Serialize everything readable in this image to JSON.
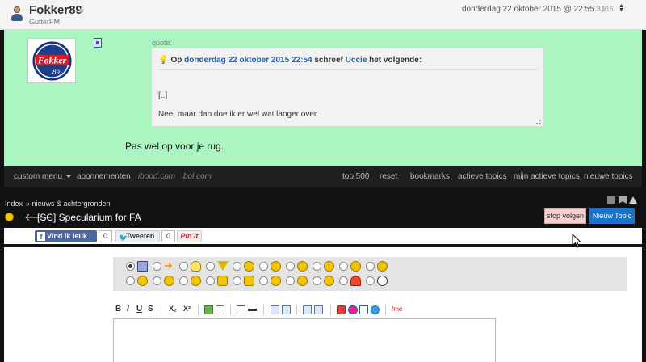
{
  "post": {
    "username": "Fokker89",
    "user_title": "GutterFM",
    "date": "donderdag 22 oktober 2015 @ 22:55",
    "seconds": ":31",
    "post_number": "#16",
    "star": "★",
    "quote_label": "quote:",
    "quote": {
      "prefix": "Op",
      "date_link": "donderdag 22 oktober 2015 22:54",
      "middle": "schreef",
      "author": "Uccie",
      "suffix": "het volgende:",
      "line1": "[..]",
      "line2": "Nee, maar dan doe ik er wel wat langer over."
    },
    "text": "Pas wel op voor je rug."
  },
  "nav": {
    "custom_menu": "custom menu",
    "abonnementen": "abonnementen",
    "ibood": "ibood.com",
    "bol": "bol.com",
    "top500": "top 500",
    "reset": "reset",
    "bookmarks": "bookmarks",
    "actieve_topics": "actieve topics",
    "mijn_actieve_topics": "mijn actieve topics",
    "nieuwe_topics": "nieuwe topics"
  },
  "topic": {
    "breadcrumb_index": "Index",
    "breadcrumb_sub": "» nieuws & achtergronden",
    "title": "[SC] Specularium for FA",
    "stop_button": "stop volgen",
    "new_button": "Nieuw Topic"
  },
  "social": {
    "fb_label": "Vind ik leuk",
    "fb_letter": "f",
    "fb_count": "0",
    "tw_label": "Tweeten",
    "tw_count": "0",
    "pin_label": "Pin it"
  },
  "editor": {
    "bold": "B",
    "italic": "I",
    "underline": "U",
    "strike": "S",
    "sub": "X₂",
    "sup": "X²",
    "me": "/me"
  }
}
